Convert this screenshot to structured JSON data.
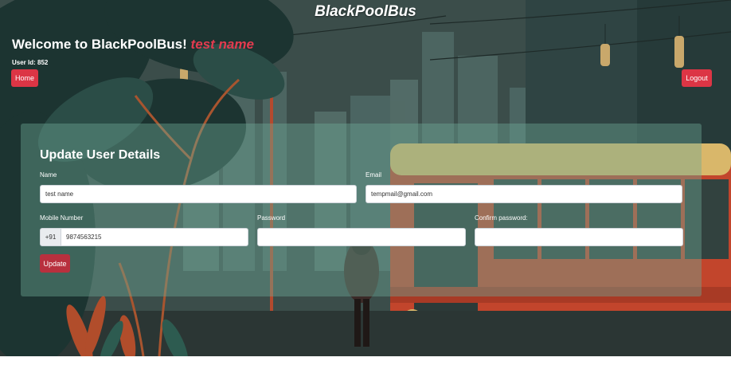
{
  "header": {
    "brand": "BlackPoolBus"
  },
  "welcome": {
    "prefix": "Welcome to BlackPoolBus!",
    "username": "test name"
  },
  "user_id_text": "User Id: 852",
  "nav": {
    "home_label": "Home",
    "logout_label": "Logout"
  },
  "form": {
    "title": "Update User Details",
    "name_label": "Name",
    "name_value": "test name",
    "email_label": "Email",
    "email_value": "tempmail@gmail.com",
    "mobile_label": "Mobile Number",
    "mobile_prefix": "+91",
    "mobile_value": "9874563215",
    "password_label": "Password",
    "password_value": "",
    "confirm_label": "Confirm password:",
    "confirm_value": "",
    "update_label": "Update"
  },
  "colors": {
    "accent": "#dc3545",
    "username": "#e23b4f"
  }
}
